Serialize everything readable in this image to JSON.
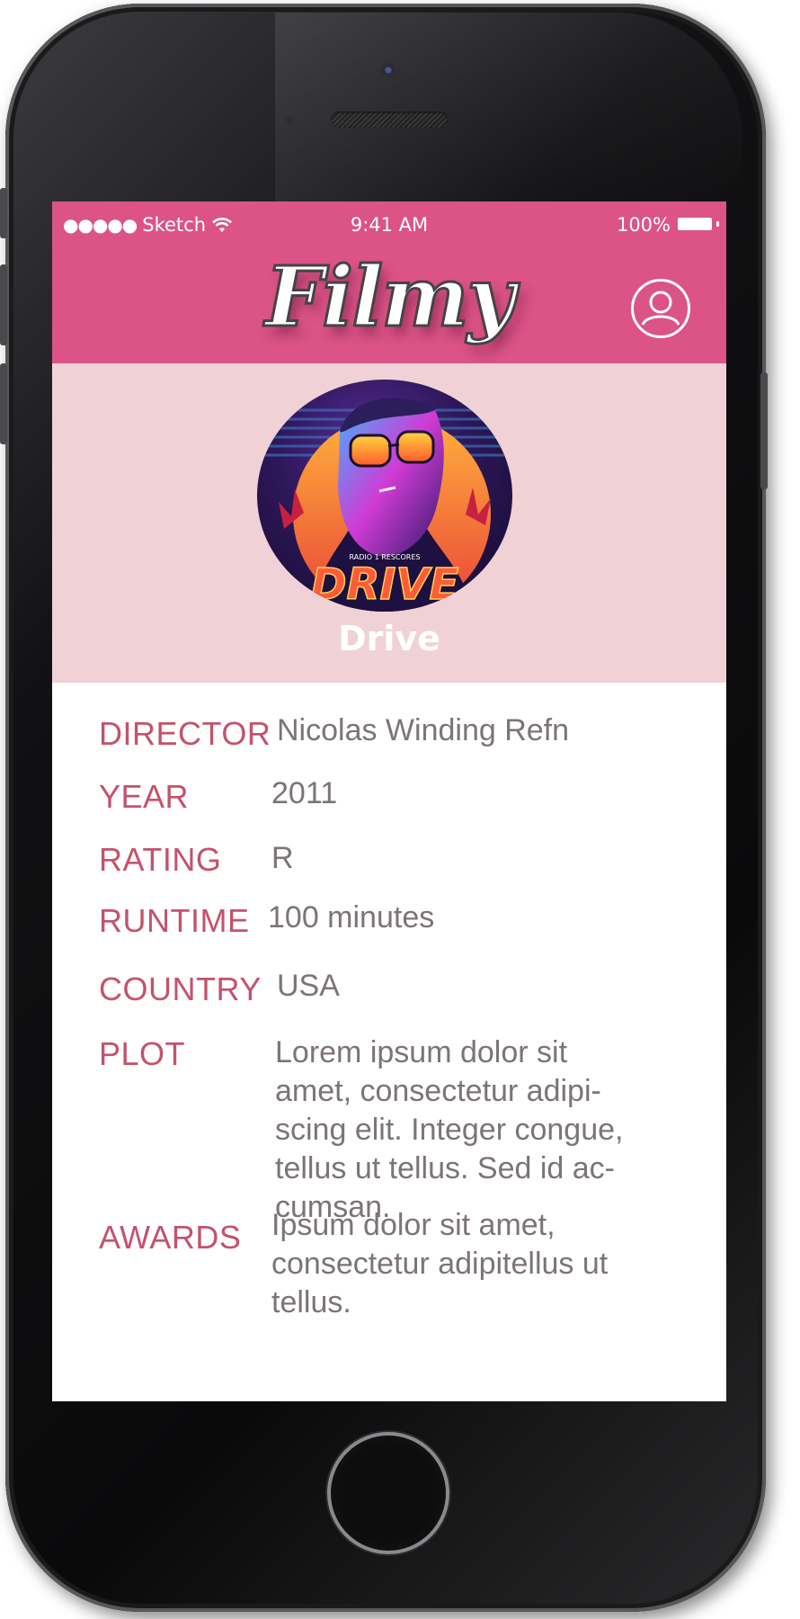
{
  "status_bar": {
    "signal": "●●●●●",
    "carrier": "Sketch",
    "time": "9:41 AM",
    "battery": "100%"
  },
  "header": {
    "app_title": "Filmy",
    "profile_icon": "user-circle-icon"
  },
  "movie": {
    "title": "Drive",
    "poster_text": "DRIVE",
    "poster_subtext": "RADIO 1 RESCORES"
  },
  "details": [
    {
      "label": "DIRECTOR",
      "value": "Nicolas Winding Refn"
    },
    {
      "label": "YEAR",
      "value": "2011"
    },
    {
      "label": "RATING",
      "value": "R"
    },
    {
      "label": "RUNTIME",
      "value": "100 minutes"
    },
    {
      "label": "COUNTRY",
      "value": "USA"
    },
    {
      "label": "PLOT",
      "value": "Lorem ipsum dolor sit amet, consectetur adipi-scing elit. Integer congue, tellus ut tellus. Sed id ac-cumsan."
    },
    {
      "label": "AWARDS",
      "value": "Ipsum dolor sit amet, consectetur adipitellus ut tellus."
    }
  ],
  "colors": {
    "header": "#dc5386",
    "hero": "#f0d2d6",
    "label": "#c4526c",
    "value": "#7c7476"
  }
}
